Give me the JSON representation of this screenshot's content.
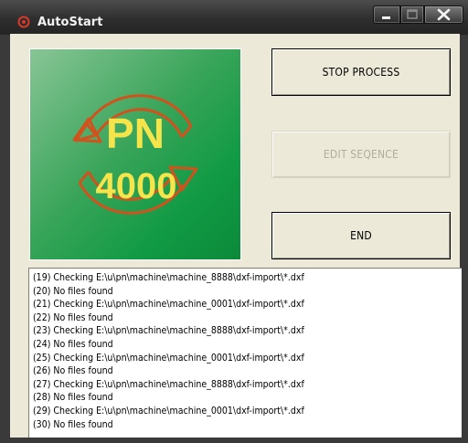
{
  "window": {
    "title": "AutoStart"
  },
  "logo": {
    "line1": "PN",
    "line2": "4000"
  },
  "buttons": {
    "stop": "STOP PROCESS",
    "edit": "EDIT SEQENCE",
    "end": "END"
  },
  "log": {
    "lines": [
      "(19) Checking E:\\u\\pn\\machine\\machine_8888\\dxf-import\\*.dxf",
      "(20) No files found",
      "(21) Checking E:\\u\\pn\\machine\\machine_0001\\dxf-import\\*.dxf",
      "(22) No files found",
      "(23) Checking E:\\u\\pn\\machine\\machine_8888\\dxf-import\\*.dxf",
      "(24) No files found",
      "(25) Checking E:\\u\\pn\\machine\\machine_0001\\dxf-import\\*.dxf",
      "(26) No files found",
      "(27) Checking E:\\u\\pn\\machine\\machine_8888\\dxf-import\\*.dxf",
      "(28) No files found",
      "(29) Checking E:\\u\\pn\\machine\\machine_0001\\dxf-import\\*.dxf",
      "(30) No files found"
    ]
  },
  "colors": {
    "logo_text": "#f5e44a",
    "logo_arrows": "#d2521e",
    "logo_green": "#119a44"
  }
}
